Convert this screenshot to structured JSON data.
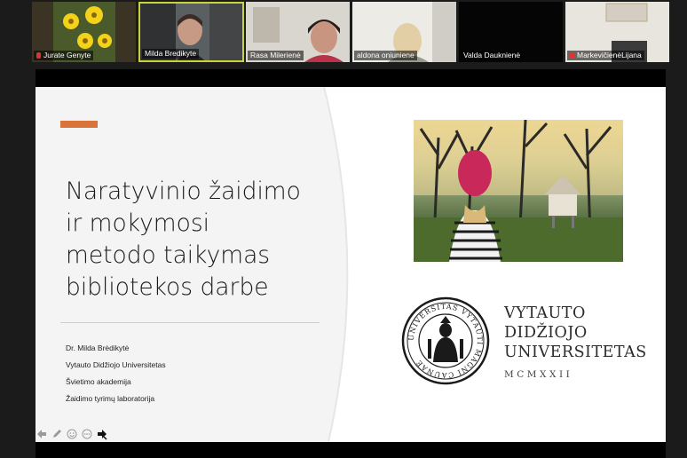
{
  "participants": [
    {
      "name": "Jurate Genyte",
      "muted": true,
      "active": false
    },
    {
      "name": "Milda Bredikyte",
      "muted": false,
      "active": true
    },
    {
      "name": "Rasa Milerienė",
      "muted": false,
      "active": false
    },
    {
      "name": "aldona oniuniene",
      "muted": false,
      "active": false
    },
    {
      "name": "Valda Dauknienė",
      "muted": false,
      "active": false
    },
    {
      "name": "MarkevičienėLijana",
      "muted": true,
      "active": false
    }
  ],
  "slide": {
    "title_lines": [
      "Naratyvinio žaidimo",
      "ir mokymosi",
      "metodo taikymas",
      "bibliotekos darbe"
    ],
    "author_lines": [
      "Dr. Milda Brėdikytė",
      "Vytauto Didžiojo Universitetas",
      "Švietimo akademija",
      "Žaidimo tyrimų laboratorija"
    ],
    "university": {
      "name_lines": [
        "VYTAUTO",
        "DIDŽIOJO",
        "UNIVERSITETAS"
      ],
      "year": "MCMXXII",
      "seal_text": "UNIVERSITAS VYTAUTI MAGNI CAUNAE"
    }
  },
  "colors": {
    "accent": "#d8733a",
    "active_speaker": "#c9d33c",
    "mic_muted": "#e0342a"
  },
  "toolbar": {
    "icons": [
      "arrow-left-icon",
      "pen-icon",
      "emoji-icon",
      "more-icon",
      "pointer-icon"
    ]
  }
}
